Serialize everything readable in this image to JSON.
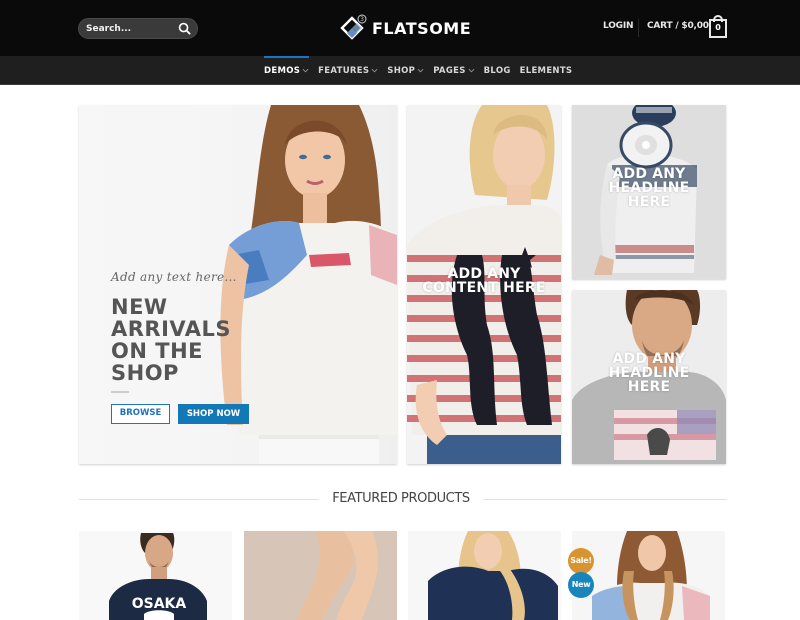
{
  "header": {
    "search_placeholder": "Search...",
    "logo_text": "FLATSOME",
    "logo_badge": "3",
    "login_label": "LOGIN",
    "cart_label": "CART / $0,00",
    "cart_count": "0"
  },
  "nav": {
    "items": [
      {
        "label": "DEMOS",
        "dropdown": true,
        "active": true
      },
      {
        "label": "FEATURES",
        "dropdown": true,
        "active": false
      },
      {
        "label": "SHOP",
        "dropdown": true,
        "active": false
      },
      {
        "label": "PAGES",
        "dropdown": true,
        "active": false
      },
      {
        "label": "BLOG",
        "dropdown": false,
        "active": false
      },
      {
        "label": "ELEMENTS",
        "dropdown": false,
        "active": false
      }
    ],
    "accent_color": "#1e73be"
  },
  "hero": {
    "main": {
      "script_text": "Add any text here...",
      "title_lines": [
        "NEW",
        "ARRIVALS",
        "ON THE",
        "SHOP"
      ],
      "browse_label": "BROWSE",
      "shop_now_label": "SHOP NOW"
    },
    "middle": {
      "overlay_lines": [
        "ADD ANY",
        "CONTENT HERE"
      ]
    },
    "top_right": {
      "overlay_lines": [
        "ADD ANY",
        "HEADLINE",
        "HERE"
      ]
    },
    "bottom_right": {
      "overlay_lines": [
        "ADD ANY",
        "HEADLINE",
        "HERE"
      ]
    }
  },
  "featured": {
    "title": "FEATURED PRODUCTS",
    "products": [
      {
        "image": "man in navy OSAKA t-shirt",
        "shirt_text": "OSAKA",
        "badges": []
      },
      {
        "image": "legs on beige background",
        "badges": []
      },
      {
        "image": "blonde woman in navy sweater",
        "badges": []
      },
      {
        "image": "woman in floral top",
        "badges": [
          "Sale!",
          "New"
        ]
      }
    ],
    "badge_colors": {
      "sale": "#d9932f",
      "new": "#1a84bd"
    }
  }
}
